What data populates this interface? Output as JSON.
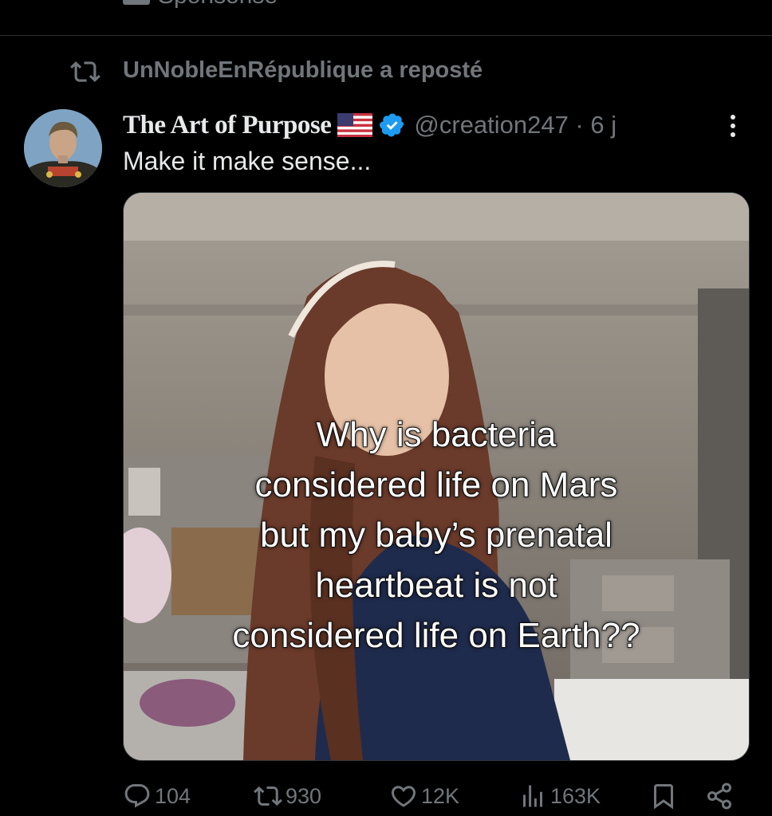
{
  "top": {
    "cutoff_label": "Sponsorisé"
  },
  "repost": {
    "icon": "repost-icon",
    "label": "UnNobleEnRépublique a reposté"
  },
  "tweet": {
    "author_name": "The Art of Purpose",
    "flag_icon": "us-flag-icon",
    "verified_icon": "verified-badge-icon",
    "handle_time": "@creation247 · 6 j",
    "text": "Make it make sense...",
    "media_caption": [
      "Why is bacteria",
      "considered life on Mars",
      "but my baby’s prenatal",
      "heartbeat is not",
      "considered life on Earth??"
    ]
  },
  "actions": {
    "replies": "104",
    "reposts": "930",
    "likes": "12K",
    "views": "163K"
  },
  "colors": {
    "background": "#000000",
    "text": "#e7e9ea",
    "muted": "#71767b",
    "verified": "#1d9bf0"
  }
}
